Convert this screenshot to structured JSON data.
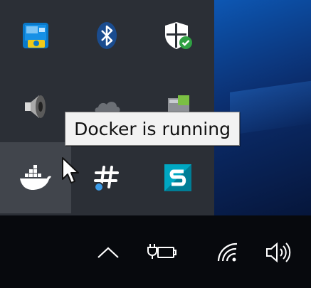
{
  "tray_overflow": {
    "icons": [
      {
        "name": "intel-graphics-icon"
      },
      {
        "name": "bluetooth-icon"
      },
      {
        "name": "windows-security-icon"
      },
      {
        "name": "speaker-icon"
      },
      {
        "name": "onedrive-icon"
      },
      {
        "name": "dell-icon"
      },
      {
        "name": "docker-icon"
      },
      {
        "name": "slack-icon"
      },
      {
        "name": "sketchbook-icon"
      }
    ],
    "tooltip": "Docker is running"
  },
  "taskbar": {
    "icons": [
      "chevron-up-icon",
      "power-plug-battery-icon",
      "wifi-icon",
      "volume-icon"
    ]
  },
  "colors": {
    "overflow_bg": "#2b2f36",
    "hover_bg": "#41454c",
    "taskbar_bg": "#07090d",
    "docker_white": "#ffffff",
    "security_green": "#2fa043",
    "slack_blue": "#3b9be8",
    "sketchbook_teal": "#00a7c2"
  }
}
